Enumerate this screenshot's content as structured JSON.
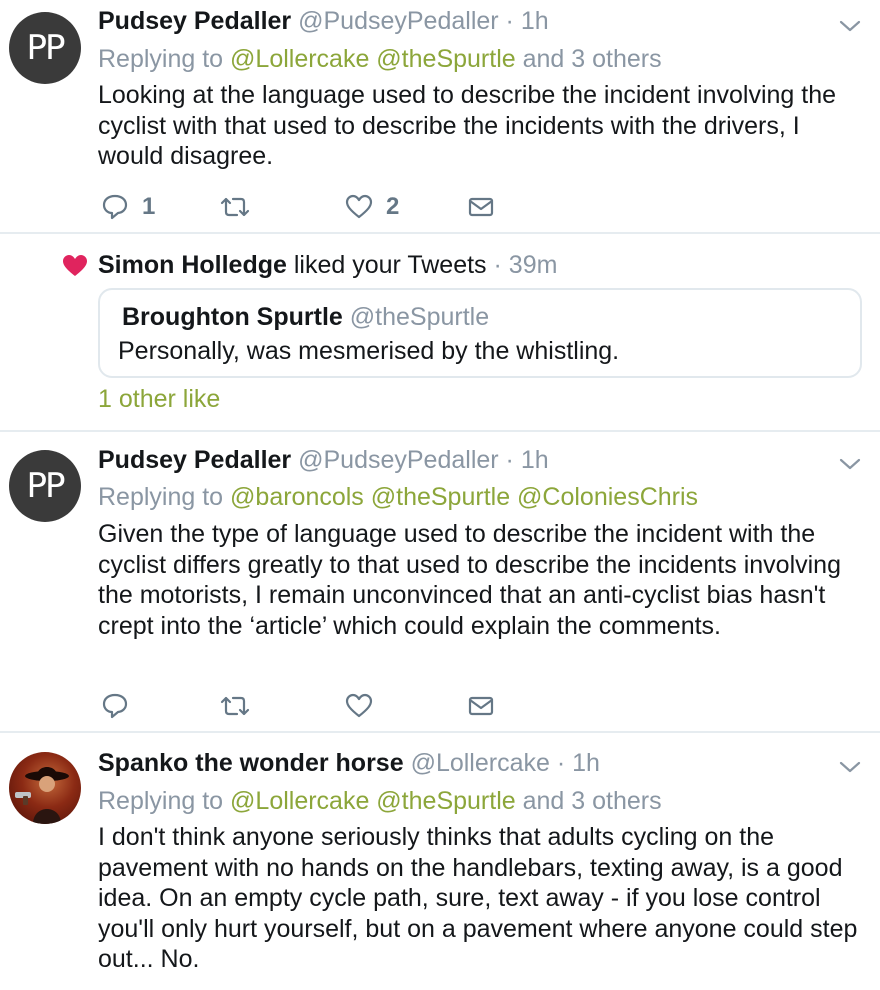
{
  "colors": {
    "link": "#8ca63a",
    "muted": "#8a96a3",
    "heart": "#e0245e"
  },
  "tweets": [
    {
      "avatar_text": "PP",
      "name": "Pudsey Pedaller",
      "handle": "@PudseyPedaller · 1h",
      "replying_label": "Replying to",
      "replying_to": "@Lollercake @theSpurtle",
      "replying_suffix": "and 3 others",
      "text": "Looking at the language used to describe the incident involving the cyclist with that used to describe the incidents with the drivers, I would disagree.",
      "reply_count": "1",
      "like_count": "2"
    },
    {
      "avatar_text": "PP",
      "name": "Pudsey Pedaller",
      "handle": "@PudseyPedaller · 1h",
      "replying_label": "Replying to",
      "replying_to": "@baroncols @theSpurtle @ColoniesChris",
      "text": "Given the type of language used to describe the incident with the cyclist differs greatly to that used to describe the incidents involving the motorists, I remain unconvinced that an anti-cyclist bias hasn't crept into the ‘article’ which could explain the comments."
    },
    {
      "name": "Spanko the wonder horse",
      "handle": "@Lollercake · 1h",
      "replying_label": "Replying to",
      "replying_to": "@Lollercake @theSpurtle",
      "replying_suffix": "and 3 others",
      "text": "I don't think anyone seriously thinks that adults cycling on the pavement with no hands on the handlebars, texting away, is a good idea. On an empty cycle path, sure, text away - if you lose control you'll only hurt yourself, but on a pavement where anyone could step out... No."
    }
  ],
  "like_notification": {
    "liker": "Simon Holledge",
    "action": "liked your Tweets",
    "time": "· 39m",
    "quoted_name": "Broughton Spurtle",
    "quoted_handle": "@theSpurtle",
    "quoted_text": "Personally, was mesmerised by the whistling.",
    "other_likes": "1 other like"
  }
}
